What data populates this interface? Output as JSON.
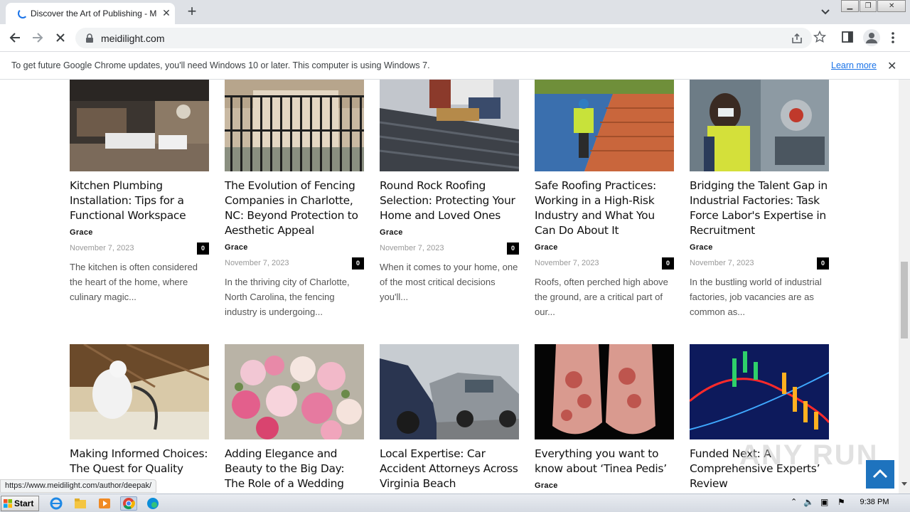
{
  "browser": {
    "tab_title": "Discover the Art of Publishing - Meidilight",
    "url": "meidilight.com",
    "infobar_message": "To get future Google Chrome updates, you'll need Windows 10 or later. This computer is using Windows 7.",
    "infobar_link": "Learn more",
    "status_url": "https://www.meidilight.com/author/deepak/"
  },
  "row1": [
    {
      "title": "Kitchen Plumbing Installation: Tips for a Functional Workspace",
      "author": "Grace",
      "date": "November 7, 2023",
      "comments": "0",
      "excerpt": "The kitchen is often considered the heart of the home, where culinary magic..."
    },
    {
      "title": "The Evolution of Fencing Companies in Charlotte, NC: Beyond Protection to Aesthetic Appeal",
      "author": "Grace",
      "date": "November 7, 2023",
      "comments": "0",
      "excerpt": "In the thriving city of Charlotte, North Carolina, the fencing industry is undergoing..."
    },
    {
      "title": "Round Rock Roofing Selection: Protecting Your Home and Loved Ones",
      "author": "Grace",
      "date": "November 7, 2023",
      "comments": "0",
      "excerpt": "When it comes to your home, one of the most critical decisions you'll..."
    },
    {
      "title": "Safe Roofing Practices: Working in a High-Risk Industry and What You Can Do About It",
      "author": "Grace",
      "date": "November 7, 2023",
      "comments": "0",
      "excerpt": "Roofs, often perched high above the ground, are a critical part of our..."
    },
    {
      "title": "Bridging the Talent Gap in Industrial Factories: Task Force Labor's Expertise in Recruitment",
      "author": "Grace",
      "date": "November 7, 2023",
      "comments": "0",
      "excerpt": "In the bustling world of industrial factories, job vacancies are as common as..."
    }
  ],
  "row2": [
    {
      "title": "Making Informed Choices: The Quest for Quality"
    },
    {
      "title": "Adding Elegance and Beauty to the Big Day: The Role of a Wedding Florist"
    },
    {
      "title": "Local Expertise: Car Accident Attorneys Across Virginia Beach"
    },
    {
      "title": "Everything you want to know about ‘Tinea Pedis’",
      "author": "Grace"
    },
    {
      "title": "Funded Next: A Comprehensive Experts’ Review"
    }
  ],
  "watermark": "ANY RUN",
  "taskbar": {
    "start_label": "Start",
    "clock": "9:38 PM"
  },
  "icons": [
    "spinner-icon",
    "close-icon",
    "plus-icon",
    "back-icon",
    "forward-icon",
    "stop-icon",
    "lock-icon",
    "share-icon",
    "star-icon",
    "sidepanel-icon",
    "profile-icon",
    "menu-icon",
    "chevron-up-icon"
  ]
}
